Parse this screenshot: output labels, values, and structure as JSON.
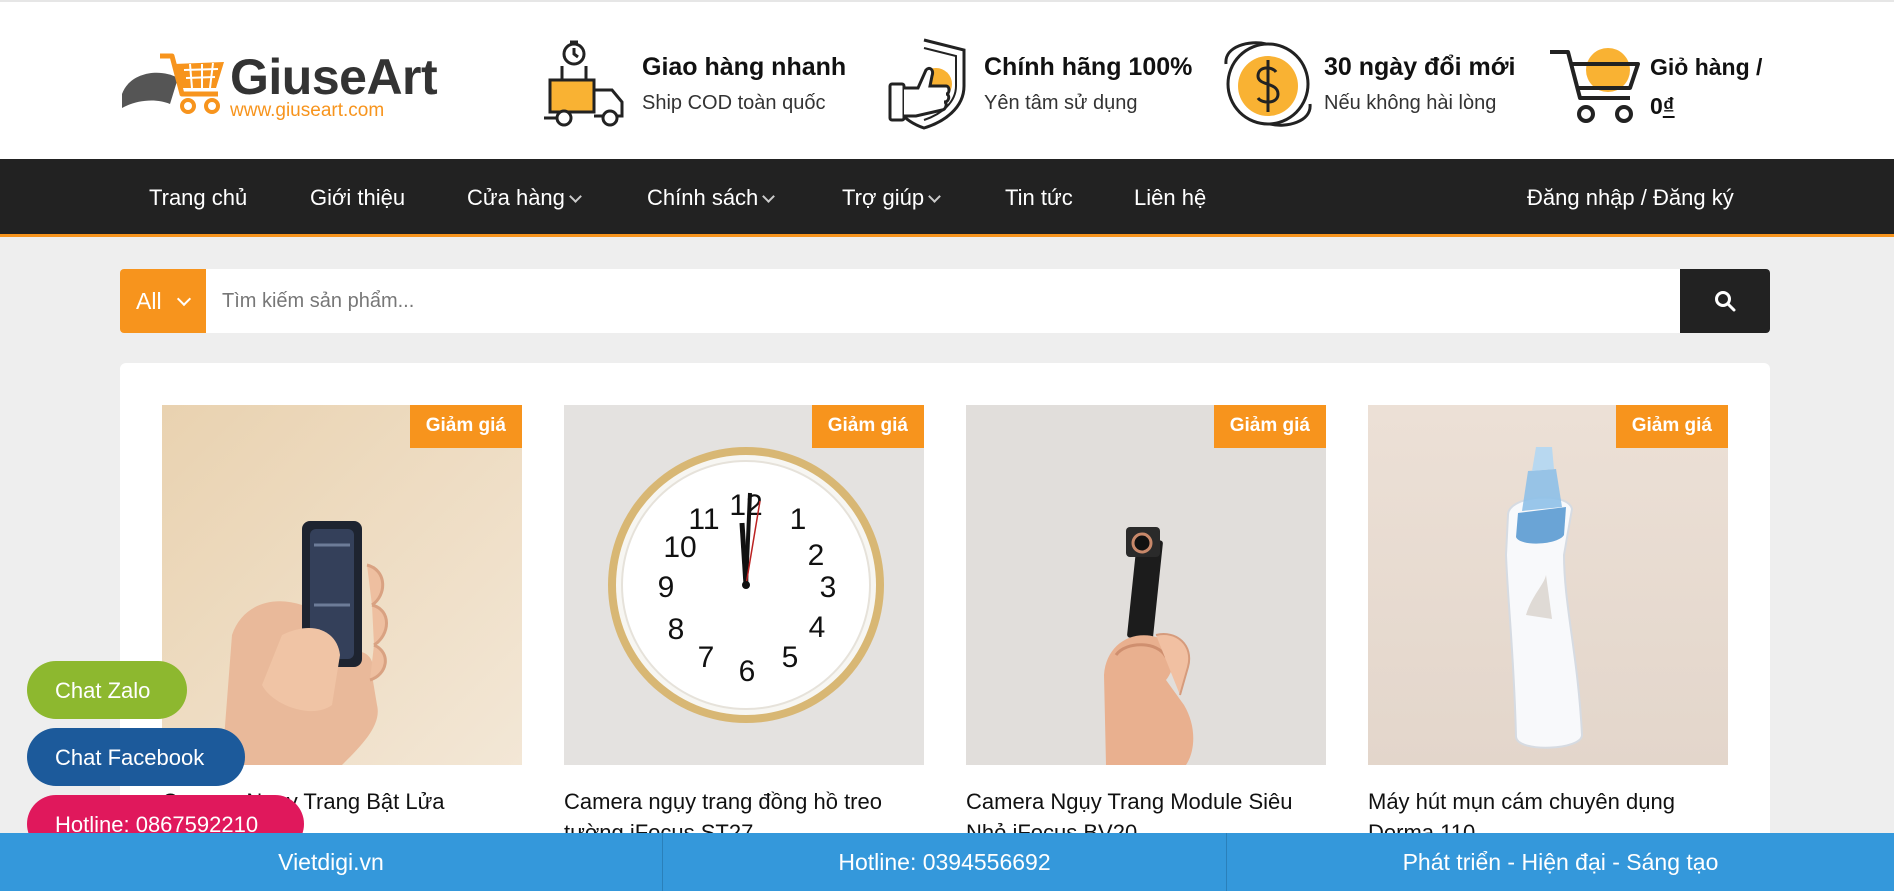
{
  "brand": {
    "name": "GiuseArt",
    "url": "www.giuseart.com",
    "accent": "#f7941d"
  },
  "features": [
    {
      "icon": "delivery-truck-icon",
      "title": "Giao hàng nhanh",
      "subtitle": "Ship COD toàn quốc"
    },
    {
      "icon": "thumbs-up-shield-icon",
      "title": "Chính hãng 100%",
      "subtitle": "Yên tâm sử dụng"
    },
    {
      "icon": "dollar-exchange-icon",
      "title": "30 ngày đổi mới",
      "subtitle": "Nếu không hài lòng"
    }
  ],
  "cart": {
    "icon": "shopping-cart-icon",
    "label": "Giỏ hàng /",
    "amount": "0",
    "currency": "₫"
  },
  "nav": {
    "items": [
      {
        "label": "Trang chủ",
        "has_dropdown": false
      },
      {
        "label": "Giới thiệu",
        "has_dropdown": false
      },
      {
        "label": "Cửa hàng",
        "has_dropdown": true
      },
      {
        "label": "Chính sách",
        "has_dropdown": true
      },
      {
        "label": "Trợ giúp",
        "has_dropdown": true
      },
      {
        "label": "Tin tức",
        "has_dropdown": false
      },
      {
        "label": "Liên hệ",
        "has_dropdown": false
      }
    ],
    "account": "Đăng nhập / Đăng ký"
  },
  "search": {
    "category": "All",
    "placeholder": "Tìm kiếm sản phẩm...",
    "value": ""
  },
  "products": [
    {
      "badge": "Giảm giá",
      "name": "Camera Ngụy Trang Bật Lửa"
    },
    {
      "badge": "Giảm giá",
      "name": "Camera ngụy trang đồng hồ treo tường iFocus ST27"
    },
    {
      "badge": "Giảm giá",
      "name": "Camera Ngụy Trang Module Siêu Nhỏ iFocus BV20"
    },
    {
      "badge": "Giảm giá",
      "name": "Máy hút mụn cám chuyên dụng Derma 110"
    }
  ],
  "float_chat": {
    "zalo": {
      "label": "Chat Zalo",
      "color": "#8db82f"
    },
    "facebook": {
      "label": "Chat Facebook",
      "color": "#1c5a9b"
    },
    "hotline": {
      "label": "Hotline: 0867592210",
      "color": "#e0185c"
    }
  },
  "bottom_bar": {
    "site": "Vietdigi.vn",
    "hotline": "Hotline: 0394556692",
    "slogan": "Phát triển - Hiện đại - Sáng tạo",
    "color": "#3498db"
  }
}
